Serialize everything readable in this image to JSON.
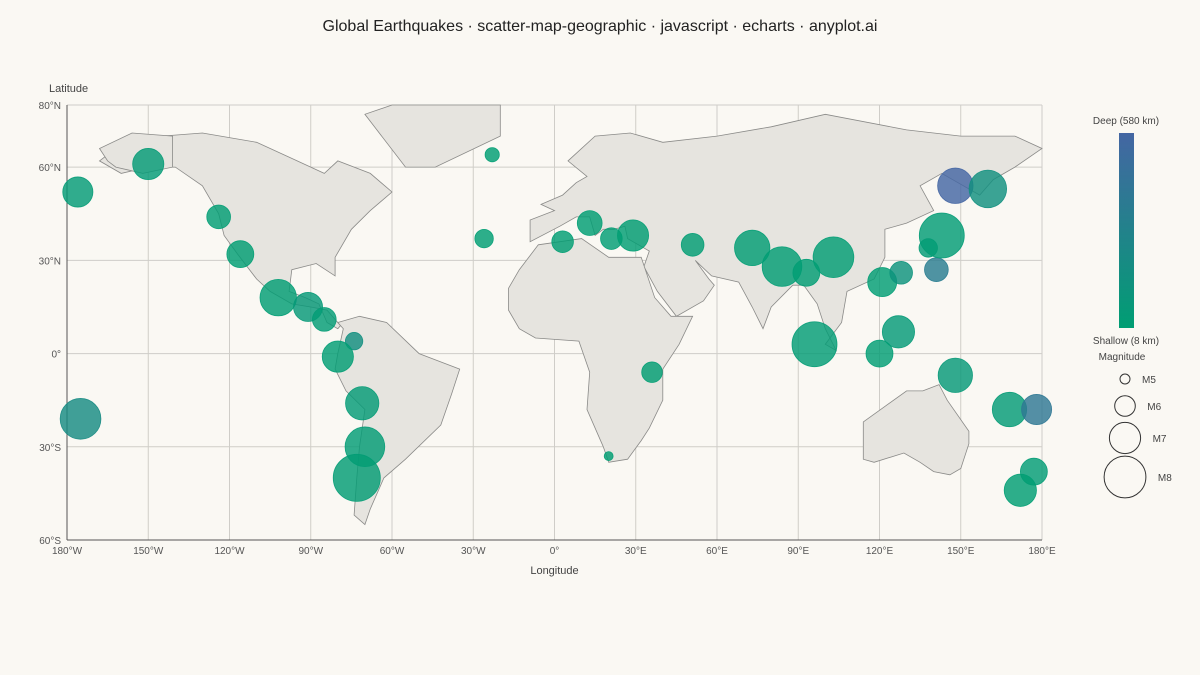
{
  "title": "Global Earthquakes · scatter-map-geographic · javascript · echarts · anyplot.ai",
  "chart_data": {
    "type": "scatter",
    "title": "Global Earthquakes · scatter-map-geographic · javascript · echarts · anyplot.ai",
    "xlabel": "Longitude",
    "ylabel": "Latitude",
    "xlim": [
      -180,
      180
    ],
    "ylim": [
      -60,
      80
    ],
    "grid": true,
    "x_ticks": [
      {
        "value": -180,
        "label": "180°W"
      },
      {
        "value": -150,
        "label": "150°W"
      },
      {
        "value": -120,
        "label": "120°W"
      },
      {
        "value": -90,
        "label": "90°W"
      },
      {
        "value": -60,
        "label": "60°W"
      },
      {
        "value": -30,
        "label": "30°W"
      },
      {
        "value": 0,
        "label": "0°"
      },
      {
        "value": 30,
        "label": "30°E"
      },
      {
        "value": 60,
        "label": "60°E"
      },
      {
        "value": 90,
        "label": "90°E"
      },
      {
        "value": 120,
        "label": "120°E"
      },
      {
        "value": 150,
        "label": "150°E"
      },
      {
        "value": 180,
        "label": "180°E"
      }
    ],
    "y_ticks": [
      {
        "value": 80,
        "label": "80°N"
      },
      {
        "value": 60,
        "label": "60°N"
      },
      {
        "value": 30,
        "label": "30°N"
      },
      {
        "value": 0,
        "label": "0°"
      },
      {
        "value": -30,
        "label": "30°S"
      },
      {
        "value": -60,
        "label": "60°S"
      }
    ],
    "depth_legend": {
      "max_label": "Deep (580 km)",
      "min_label": "Shallow (8 km)",
      "min_depth": 8,
      "max_depth": 580,
      "color_shallow": "#009e73",
      "color_deep": "#4466a3"
    },
    "size_legend": {
      "title": "Magnitude",
      "items": [
        {
          "label": "M5",
          "magnitude": 5
        },
        {
          "label": "M6",
          "magnitude": 6
        },
        {
          "label": "M7",
          "magnitude": 7
        },
        {
          "label": "M8",
          "magnitude": 8
        }
      ]
    },
    "points": [
      {
        "lon": -176,
        "lat": 52,
        "mag": 6.9,
        "depth": 40
      },
      {
        "lon": -150,
        "lat": 61,
        "mag": 7.0,
        "depth": 40
      },
      {
        "lon": -124,
        "lat": 44,
        "mag": 6.3,
        "depth": 15
      },
      {
        "lon": -116,
        "lat": 32,
        "mag": 6.6,
        "depth": 10
      },
      {
        "lon": -102,
        "lat": 18,
        "mag": 7.5,
        "depth": 20
      },
      {
        "lon": -91,
        "lat": 15,
        "mag": 6.8,
        "depth": 60
      },
      {
        "lon": -85,
        "lat": 11,
        "mag": 6.3,
        "depth": 30
      },
      {
        "lon": -74,
        "lat": 4,
        "mag": 5.7,
        "depth": 160
      },
      {
        "lon": -80,
        "lat": -1,
        "mag": 7.0,
        "depth": 20
      },
      {
        "lon": -71,
        "lat": -16,
        "mag": 7.2,
        "depth": 40
      },
      {
        "lon": -70,
        "lat": -30,
        "mag": 7.8,
        "depth": 30
      },
      {
        "lon": -73,
        "lat": -40,
        "mag": 8.5,
        "depth": 25
      },
      {
        "lon": -175,
        "lat": -21,
        "mag": 7.9,
        "depth": 200
      },
      {
        "lon": -23,
        "lat": 64,
        "mag": 5.4,
        "depth": 10
      },
      {
        "lon": -26,
        "lat": 37,
        "mag": 5.8,
        "depth": 10
      },
      {
        "lon": 3,
        "lat": 36,
        "mag": 6.1,
        "depth": 10
      },
      {
        "lon": 13,
        "lat": 42,
        "mag": 6.4,
        "depth": 10
      },
      {
        "lon": 21,
        "lat": 37,
        "mag": 6.1,
        "depth": 15
      },
      {
        "lon": 29,
        "lat": 38,
        "mag": 7.0,
        "depth": 10
      },
      {
        "lon": 51,
        "lat": 35,
        "mag": 6.2,
        "depth": 15
      },
      {
        "lon": 73,
        "lat": 34,
        "mag": 7.4,
        "depth": 15
      },
      {
        "lon": 84,
        "lat": 28,
        "mag": 7.8,
        "depth": 15
      },
      {
        "lon": 93,
        "lat": 26,
        "mag": 6.6,
        "depth": 20
      },
      {
        "lon": 103,
        "lat": 31,
        "mag": 7.9,
        "depth": 20
      },
      {
        "lon": 36,
        "lat": -6,
        "mag": 6.0,
        "depth": 10
      },
      {
        "lon": 20,
        "lat": -33,
        "mag": 4.9,
        "depth": 10
      },
      {
        "lon": 96,
        "lat": 3,
        "mag": 8.3,
        "depth": 30
      },
      {
        "lon": 121,
        "lat": 23,
        "mag": 6.8,
        "depth": 20
      },
      {
        "lon": 128,
        "lat": 26,
        "mag": 6.2,
        "depth": 120
      },
      {
        "lon": 127,
        "lat": 7,
        "mag": 7.1,
        "depth": 50
      },
      {
        "lon": 120,
        "lat": 0,
        "mag": 6.6,
        "depth": 20
      },
      {
        "lon": 138,
        "lat": 34,
        "mag": 5.8,
        "depth": 40
      },
      {
        "lon": 141,
        "lat": 27,
        "mag": 6.3,
        "depth": 350
      },
      {
        "lon": 143,
        "lat": 38,
        "mag": 8.3,
        "depth": 30
      },
      {
        "lon": 148,
        "lat": -7,
        "mag": 7.3,
        "depth": 60
      },
      {
        "lon": 148,
        "lat": 54,
        "mag": 7.4,
        "depth": 580
      },
      {
        "lon": 160,
        "lat": 53,
        "mag": 7.6,
        "depth": 150
      },
      {
        "lon": 168,
        "lat": -18,
        "mag": 7.3,
        "depth": 40
      },
      {
        "lon": 178,
        "lat": -18,
        "mag": 6.9,
        "depth": 400
      },
      {
        "lon": 177,
        "lat": -38,
        "mag": 6.6,
        "depth": 30
      },
      {
        "lon": 172,
        "lat": -44,
        "mag": 7.1,
        "depth": 10
      }
    ]
  }
}
